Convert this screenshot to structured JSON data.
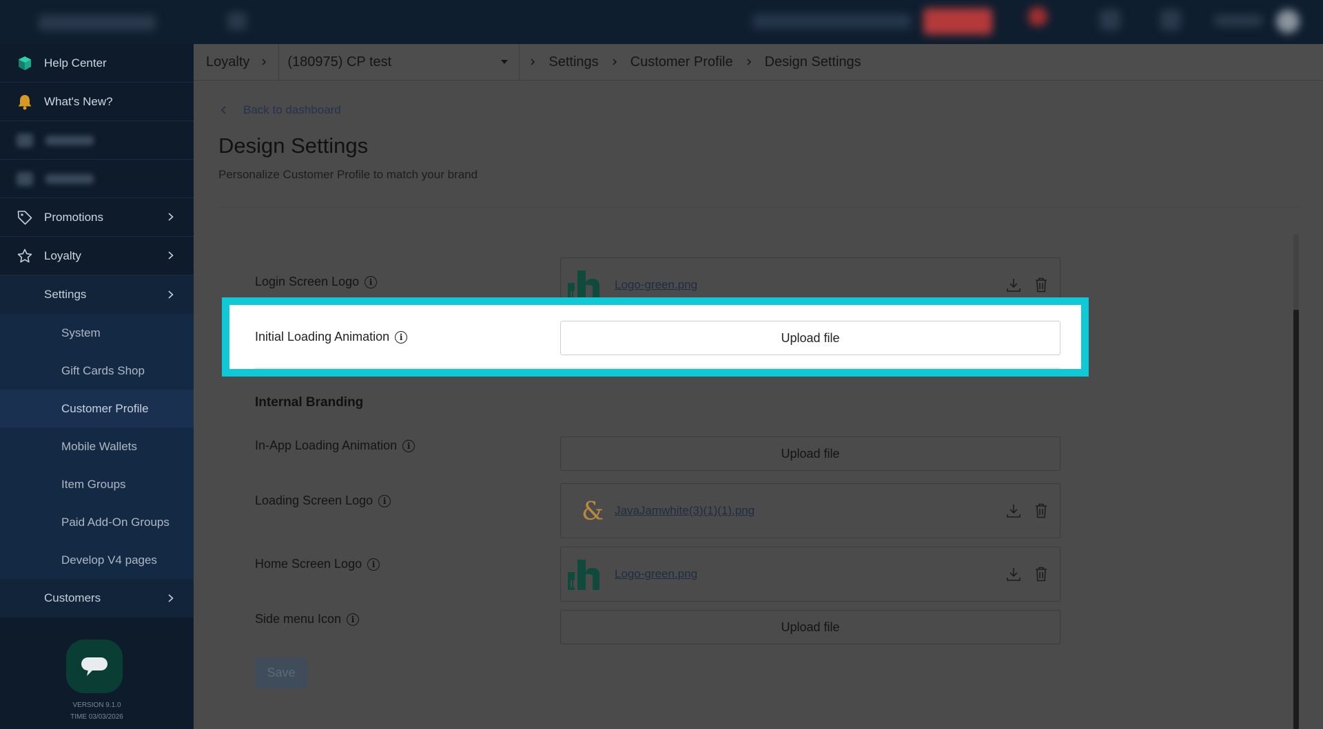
{
  "sidebar": {
    "help_center": "Help Center",
    "whats_new": "What's New?",
    "promotions": "Promotions",
    "loyalty": "Loyalty",
    "settings": "Settings",
    "sub_items": [
      "System",
      "Gift Cards Shop",
      "Customer Profile",
      "Mobile Wallets",
      "Item Groups",
      "Paid Add-On Groups",
      "Develop V4 pages"
    ],
    "customers": "Customers",
    "version": "VERSION 9.1.0",
    "time": "TIME 03/03/2026"
  },
  "breadcrumb": {
    "root": "Loyalty",
    "location": "(180975) CP test",
    "settings": "Settings",
    "customer_profile": "Customer Profile",
    "current": "Design Settings"
  },
  "page": {
    "back_link": "Back to dashboard",
    "title": "Design Settings",
    "subtitle": "Personalize Customer Profile to match your brand",
    "internal_branding": "Internal Branding",
    "save": "Save"
  },
  "rows": {
    "login_logo": {
      "label": "Login Screen Logo",
      "file": "Logo-green.png"
    },
    "initial_anim": {
      "label": "Initial Loading Animation",
      "button": "Upload file"
    },
    "inapp_anim": {
      "label": "In-App Loading Animation",
      "button": "Upload file"
    },
    "loading_logo": {
      "label": "Loading Screen Logo",
      "file": "JavaJamwhite(3)(1)(1).png"
    },
    "home_logo": {
      "label": "Home Screen Logo",
      "file": "Logo-green.png"
    },
    "side_menu": {
      "label": "Side menu Icon",
      "button": "Upload file"
    }
  },
  "colors": {
    "highlight": "#10c9d6",
    "brand_green": "#0f4a3c",
    "sidebar_bg": "#0d1b2a"
  }
}
